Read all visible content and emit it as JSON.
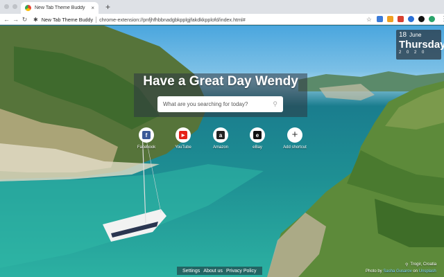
{
  "browser": {
    "tab_title": "New Tab Theme Buddy",
    "tab_close": "×",
    "new_tab": "+",
    "back": "←",
    "forward": "→",
    "reload": "↻",
    "omni_title": "New Tab Theme Buddy",
    "omni_url": "chrome-extension://pnfjhfhbbnadgbkpplgjfakdkkpplofd/index.html#",
    "star": "☆",
    "menu": "⋮",
    "extension_colors": [
      "#3b7bd8",
      "#f0a020",
      "#d84030",
      "#2a6fd6",
      "#111111",
      "#2aa36b"
    ]
  },
  "date": {
    "day": "18",
    "month": "June",
    "weekday": "Thursday",
    "year": "2 0 2 0"
  },
  "greeting": "Have a Great Day Wendy",
  "search": {
    "placeholder": "What are you searching for today?",
    "icon": "search-icon"
  },
  "shortcuts": [
    {
      "label": "Facebook",
      "glyph": "f",
      "color": "#3b5998"
    },
    {
      "label": "YouTube",
      "glyph": "▶",
      "color": "#e62117"
    },
    {
      "label": "Amazon",
      "glyph": "a",
      "color": "#222222"
    },
    {
      "label": "eBay",
      "glyph": "e",
      "color": "#111111"
    },
    {
      "label": "Add shortcut",
      "glyph": "+",
      "color": "#333333"
    }
  ],
  "footer": {
    "settings": "Settings",
    "about": "About us",
    "privacy": "Privacy Policy"
  },
  "location": "Trogir, Croatia",
  "credit": {
    "prefix": "Photo by",
    "author": "Sasha Gusarov",
    "on": "on",
    "site": "Unsplash"
  }
}
